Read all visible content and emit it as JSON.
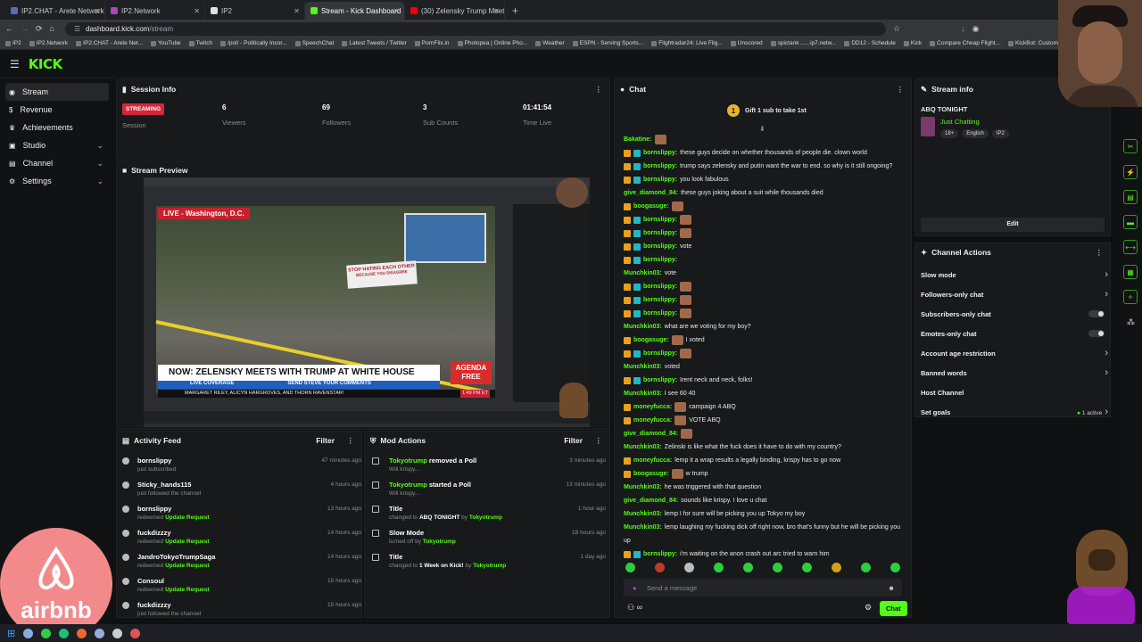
{
  "browser": {
    "tabs": [
      {
        "title": "IP2.CHAT - Arete Network",
        "color": "#5c6bc0"
      },
      {
        "title": "IP2.Network",
        "color": "#ab47bc"
      },
      {
        "title": "IP2",
        "color": "#e0e0e0"
      },
      {
        "title": "Stream - Kick Dashboard",
        "color": "#53fc18"
      },
      {
        "title": "(30) Zelensky Trump Meeting -",
        "color": "#ff0000"
      }
    ],
    "new_tab": "+",
    "url_host": "dashboard.kick.com",
    "url_path": "/stream",
    "bookmarks": [
      "IP2",
      "IP2.Network",
      "IP2.CHAT - Arete Net...",
      "YouTube",
      "Twitch",
      "/pol/ - Politically Incor...",
      "SpeechChat",
      "Latest Tweets / Twitter",
      "PornFlix.in",
      "Photopea | Online Pho...",
      "Weather",
      "ESPN - Serving Sports...",
      "Flightradar24: Live Flig...",
      "Unscored",
      "spictank ......ip7.netw...",
      "DD12 - Schedule",
      "Kick",
      "Compare Cheap Flight...",
      "KickBot: Customizable..."
    ]
  },
  "kick": {
    "logo": "KICK",
    "nav": [
      {
        "label": "Stream",
        "icon": "broadcast-icon",
        "active": true
      },
      {
        "label": "Revenue",
        "icon": "dollar-icon"
      },
      {
        "label": "Achievements",
        "icon": "trophy-icon"
      },
      {
        "label": "Studio",
        "icon": "studio-icon",
        "chevron": "⌄"
      },
      {
        "label": "Channel",
        "icon": "channel-icon",
        "chevron": "⌄"
      },
      {
        "label": "Settings",
        "icon": "gear-icon",
        "chevron": "⌄"
      }
    ]
  },
  "session": {
    "title": "Session Info",
    "status": "STREAMING",
    "status_label": "Session",
    "viewers": "6",
    "viewers_label": "Viewers",
    "followers": "69",
    "followers_label": "Followers",
    "subs": "3",
    "subs_label": "Sub Counts",
    "time": "01:41:54",
    "time_label": "Time Live"
  },
  "preview": {
    "title": "Stream Preview",
    "live_loc": "LIVE - Washington, D.C.",
    "headline": "NOW: ZELENSKY MEETS WITH TRUMP AT WHITE HOUSE",
    "subhead": "LIVE COVERAGE",
    "subhead2": "SEND STEVE YOUR COMMENTS",
    "sign": "STOP HATING EACH OTHER",
    "sign2": "BECAUSE YOU DISAGREE",
    "tag": "AGENDA FREE",
    "names": "MARGARET RILEY, ALICYN HARGROVES, AND THORN RAVENSTAR!",
    "clock": "1:49 PM ET"
  },
  "activity": {
    "title": "Activity Feed",
    "filter": "Filter",
    "items": [
      {
        "user": "bornslippy",
        "desc": "just subscribed",
        "highlight": "",
        "time": "47 minutes ago"
      },
      {
        "user": "Sticky_hands115",
        "desc": "just followed the channel",
        "highlight": "",
        "time": "4 hours ago"
      },
      {
        "user": "bornslippy",
        "desc": "redeemed ",
        "highlight": "Update Request",
        "time": "13 hours ago"
      },
      {
        "user": "fuckdizzzy",
        "desc": "redeemed ",
        "highlight": "Update Request",
        "time": "14 hours ago"
      },
      {
        "user": "JandroTokyoTrumpSaga",
        "desc": "redeemed ",
        "highlight": "Update Request",
        "time": "14 hours ago"
      },
      {
        "user": "Consoul",
        "desc": "redeemed ",
        "highlight": "Update Request",
        "time": "15 hours ago"
      },
      {
        "user": "fuckdizzzy",
        "desc": "just followed the channel",
        "highlight": "",
        "time": "15 hours ago"
      }
    ]
  },
  "mod": {
    "title": "Mod Actions",
    "filter": "Filter",
    "items": [
      {
        "user": "Tokyotrump",
        "action": " removed a Poll",
        "desc": "Will krispy...",
        "by_prefix": "",
        "by": "",
        "time": "3 minutes ago"
      },
      {
        "user": "Tokyotrump",
        "action": " started a Poll",
        "desc": "Will krispy...",
        "by_prefix": "",
        "by": "",
        "time": "13 minutes ago"
      },
      {
        "user": "",
        "action": "Title",
        "desc": "changed to ",
        "bold": "ABQ TONIGHT",
        "by_prefix": " by ",
        "by": "Tokyotrump",
        "time": "1 hour ago"
      },
      {
        "user": "",
        "action": "Slow Mode",
        "desc": "turned off by ",
        "bold": "",
        "by_prefix": "",
        "by": "Tokyotrump",
        "time": "18 hours ago"
      },
      {
        "user": "",
        "action": "Title",
        "desc": "changed to ",
        "bold": "1 Week on Kick!",
        "by_prefix": " by ",
        "by": "Tokyotrump",
        "time": "1 day ago"
      }
    ]
  },
  "chat": {
    "title": "Chat",
    "gift": "Gift 1 sub to take 1st",
    "messages": [
      {
        "user": "Bakatine:",
        "text": "",
        "badges": 0,
        "emotes": 1
      },
      {
        "user": "bornslippy:",
        "text": "these guys decide on whether thousands of people die. clown world",
        "badges": 2,
        "emotes": 0
      },
      {
        "user": "bornslippy:",
        "text": "trump says zelensky and putin want the war to end. so why is it still ongoing?",
        "badges": 2,
        "emotes": 0
      },
      {
        "user": "bornslippy:",
        "text": "you look fabulous",
        "badges": 2,
        "emotes": 0
      },
      {
        "user": "give_diamond_84:",
        "text": "these guys joking about a suit while thousands died",
        "badges": 0,
        "emotes": 0
      },
      {
        "user": "boogasuge:",
        "text": "",
        "badges": 1,
        "emotes": 1
      },
      {
        "user": "bornslippy:",
        "text": "",
        "badges": 2,
        "emotes": 1
      },
      {
        "user": "bornslippy:",
        "text": "",
        "badges": 2,
        "emotes": 1
      },
      {
        "user": "bornslippy:",
        "text": "vote",
        "badges": 2,
        "emotes": 0
      },
      {
        "user": "bornslippy:",
        "text": "",
        "badges": 2,
        "emotes": 0
      },
      {
        "user": "Munchkin03:",
        "text": "vote",
        "badges": 0,
        "emotes": 0
      },
      {
        "user": "bornslippy:",
        "text": "",
        "badges": 2,
        "emotes": 1
      },
      {
        "user": "bornslippy:",
        "text": "",
        "badges": 2,
        "emotes": 1
      },
      {
        "user": "bornslippy:",
        "text": "",
        "badges": 2,
        "emotes": 1
      },
      {
        "user": "Munchkin03:",
        "text": "what are we voting for my boy?",
        "badges": 0,
        "emotes": 0
      },
      {
        "user": "boogasuge:",
        "text": "I voted",
        "badges": 1,
        "emotes": 1
      },
      {
        "user": "bornslippy:",
        "text": "",
        "badges": 2,
        "emotes": 1
      },
      {
        "user": "Munchkin03:",
        "text": "voted",
        "badges": 0,
        "emotes": 0
      },
      {
        "user": "bornslippy:",
        "text": "Irent neck and neck, folks!",
        "badges": 2,
        "emotes": 0
      },
      {
        "user": "Munchkin03:",
        "text": "I see 60 40",
        "badges": 0,
        "emotes": 0
      },
      {
        "user": "moneyfucca:",
        "text": "campaign 4 ABQ",
        "badges": 1,
        "emotes": 1
      },
      {
        "user": "moneyfucca:",
        "text": "VOTE ABQ",
        "badges": 1,
        "emotes": 1
      },
      {
        "user": "give_diamond_84:",
        "text": "",
        "badges": 0,
        "emotes": 1
      },
      {
        "user": "Munchkin03:",
        "text": "Zelinski is like what the fuck does it have to do with my country?",
        "badges": 0,
        "emotes": 0
      },
      {
        "user": "moneyfucca:",
        "text": "lemp it a wrap results a legally binding, krispy has to go now",
        "badges": 1,
        "emotes": 0
      },
      {
        "user": "boogasuge:",
        "text": "w trump",
        "badges": 1,
        "emotes": 1
      },
      {
        "user": "Munchkin03:",
        "text": "he was triggered with that question",
        "badges": 0,
        "emotes": 0
      },
      {
        "user": "give_diamond_84:",
        "text": "sounds like krispy. I love u chat",
        "badges": 0,
        "emotes": 0
      },
      {
        "user": "Munchkin03:",
        "text": "lemp I for sure will be picking you up Tokyo my boy",
        "badges": 0,
        "emotes": 0
      },
      {
        "user": "Munchkin03:",
        "text": "lemp laughing my fucking dick off right now, bro that's funny but he will be picking you",
        "badges": 0,
        "emotes": 0
      },
      {
        "user": "",
        "text": "up",
        "badges": 0,
        "emotes": 0
      },
      {
        "user": "bornslippy:",
        "text": "i'm waiting on the anon crash out arc tried to warn him",
        "badges": 2,
        "emotes": 0
      }
    ],
    "placeholder": "Send a message",
    "send": "Chat"
  },
  "stream_info": {
    "title": "Stream info",
    "stream_title": "ABQ TONIGHT",
    "category": "Just Chatting",
    "tags": [
      "18+",
      "English",
      "IP2"
    ],
    "edit": "Edit"
  },
  "actions": {
    "title": "Channel Actions",
    "items": [
      {
        "label": "Slow mode",
        "kind": "chev"
      },
      {
        "label": "Followers-only chat",
        "kind": "chev"
      },
      {
        "label": "Subscribers-only chat",
        "kind": "toggle"
      },
      {
        "label": "Emotes-only chat",
        "kind": "toggle"
      },
      {
        "label": "Account age restriction",
        "kind": "chev"
      },
      {
        "label": "Banned words",
        "kind": "chev"
      },
      {
        "label": "Host Channel",
        "kind": "none"
      },
      {
        "label": "Set goals",
        "kind": "goal",
        "extra": "1 active"
      }
    ]
  },
  "overlay": {
    "brand": "airbnb"
  },
  "colors": {
    "accent": "#53fc18",
    "live": "#d6263a",
    "bg": "#0f1012",
    "panel": "#18191b"
  }
}
